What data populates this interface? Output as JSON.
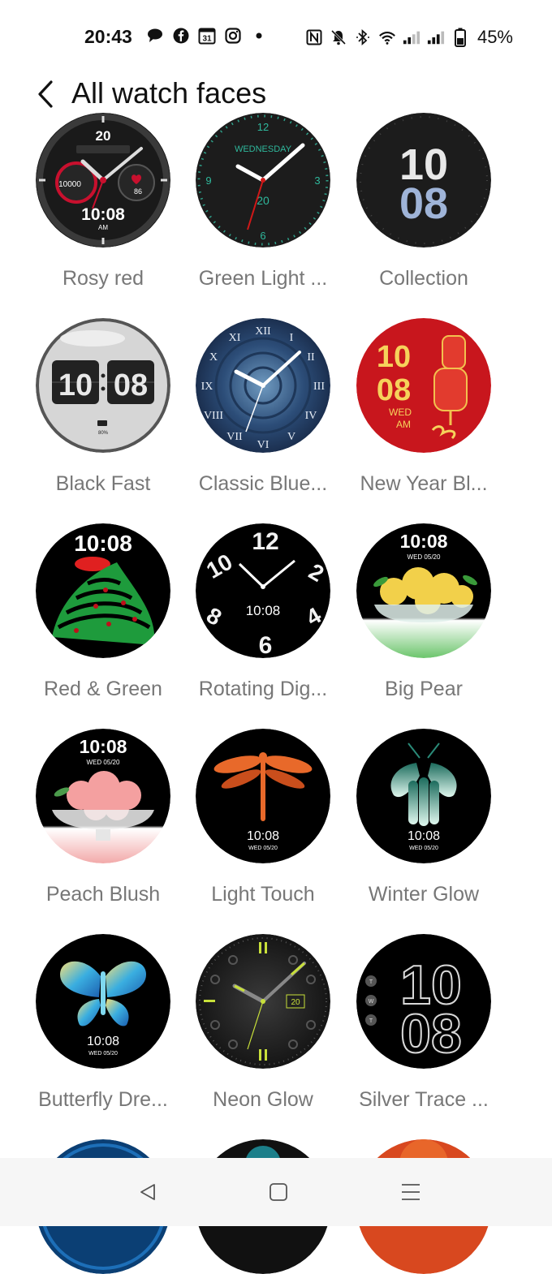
{
  "status_bar": {
    "time": "20:43",
    "battery_percent": "45%",
    "left_icons": [
      "chat-bubble-icon",
      "facebook-icon",
      "calendar-31-icon",
      "instagram-icon",
      "dot-icon"
    ],
    "right_icons": [
      "nfc-icon",
      "mute-bell-icon",
      "bluetooth-icon",
      "wifi-icon",
      "signal-1-icon",
      "signal-2-icon",
      "battery-icon"
    ],
    "calendar_day": "31"
  },
  "header": {
    "title": "All watch faces"
  },
  "watch_faces": [
    {
      "name": "Rosy red",
      "time_text": "10:08",
      "date_text": "20",
      "extra": "10000",
      "extra2": "86",
      "ampm": "AM"
    },
    {
      "name": "Green Light ...",
      "day_text": "WEDNESDAY",
      "date_text": "20"
    },
    {
      "name": "Collection",
      "hour": "10",
      "minute": "08"
    },
    {
      "name": "Black Fast",
      "hour": "10",
      "minute": "08",
      "battery": "80%"
    },
    {
      "name": "Classic Blue..."
    },
    {
      "name": "New Year Bl...",
      "hour": "10",
      "minute": "08",
      "day_text": "WED",
      "ampm": "AM"
    },
    {
      "name": "Red & Green",
      "time_text": "10:08"
    },
    {
      "name": "Rotating Dig...",
      "time_text": "10:08"
    },
    {
      "name": "Big Pear",
      "time_text": "10:08",
      "date_text": "WED 05/20"
    },
    {
      "name": "Peach Blush",
      "time_text": "10:08",
      "date_text": "WED 05/20"
    },
    {
      "name": "Light Touch",
      "time_text": "10:08",
      "date_text": "WED 05/20"
    },
    {
      "name": "Winter Glow",
      "time_text": "10:08",
      "date_text": "WED 05/20"
    },
    {
      "name": "Butterfly Dre...",
      "time_text": "10:08",
      "date_text": "WED 05/20"
    },
    {
      "name": "Neon Glow",
      "date_text": "20"
    },
    {
      "name": "Silver Trace ...",
      "hour": "10",
      "minute": "08"
    }
  ],
  "navigation": {
    "back": "back-triangle-icon",
    "home": "home-square-icon",
    "menu": "menu-lines-icon"
  },
  "colors": {
    "label_text": "#777777",
    "title_text": "#111111",
    "nav_bg": "#f6f6f6"
  }
}
